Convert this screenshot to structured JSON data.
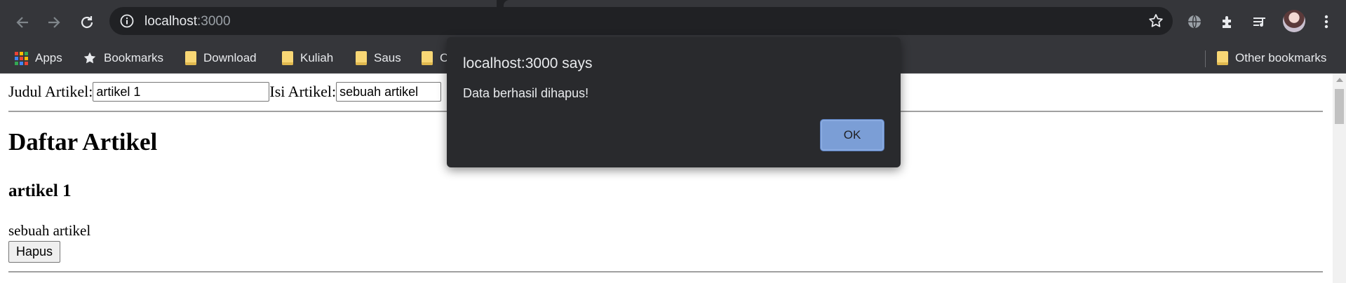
{
  "browser": {
    "url_host": "localhost",
    "url_port": ":3000",
    "bookmarks": [
      {
        "label": "Apps",
        "icon": "apps-grid-icon"
      },
      {
        "label": "Bookmarks",
        "icon": "star-icon"
      },
      {
        "label": "Download",
        "icon": "folder-icon"
      },
      {
        "label": "Kuliah",
        "icon": "folder-icon"
      },
      {
        "label": "Saus",
        "icon": "folder-icon"
      },
      {
        "label": "C",
        "icon": "folder-icon"
      }
    ],
    "other_bookmarks": "Other bookmarks"
  },
  "form": {
    "judul_label": "Judul Artikel:",
    "judul_value": "artikel 1",
    "isi_label": "Isi Artikel:",
    "isi_value": "sebuah artikel"
  },
  "list": {
    "heading": "Daftar Artikel",
    "items": [
      {
        "title": "artikel 1",
        "body": "sebuah artikel",
        "delete_label": "Hapus"
      }
    ]
  },
  "dialog": {
    "title": "localhost:3000 says",
    "message": "Data berhasil dihapus!",
    "ok_label": "OK"
  },
  "colors": {
    "chrome_bg": "#35363a",
    "omnibox_bg": "#202124",
    "dialog_bg": "#292a2d",
    "ok_button": "#7b9ed6"
  }
}
